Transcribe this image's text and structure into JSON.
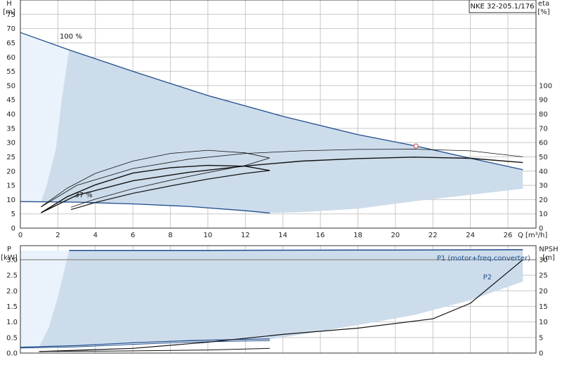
{
  "model_label": "NKE 32-205.1/176",
  "chart_data": [
    {
      "type": "line",
      "panel": "head-efficiency",
      "xlabel": "Q [m³/h]",
      "ylabel_left_name": "H",
      "ylabel_left_unit": "[m]",
      "ylabel_right_name": "eta",
      "ylabel_right_unit": "[%]",
      "xlim": [
        0,
        27.5
      ],
      "ylim_left": [
        0,
        80
      ],
      "ylim_right_ticks": [
        0,
        100
      ],
      "x_ticks": [
        0,
        2,
        4,
        6,
        8,
        10,
        12,
        14,
        16,
        18,
        20,
        22,
        24,
        26
      ],
      "y_ticks_left": [
        0,
        5,
        10,
        15,
        20,
        25,
        30,
        35,
        40,
        45,
        50,
        55,
        60,
        65,
        70,
        75
      ],
      "y_ticks_right": [
        0,
        10,
        20,
        30,
        40,
        50,
        60,
        70,
        80,
        90,
        100
      ],
      "grid": true,
      "annotations": [
        {
          "text": "100 %",
          "x": 2.1,
          "y": 66.5
        },
        {
          "text": "37 %",
          "x": 2.9,
          "y": 10.8
        }
      ],
      "duty_point": {
        "x": 21.1,
        "y": 28.8
      },
      "series": [
        {
          "role": "max-speed-head",
          "points": [
            [
              0,
              68.6
            ],
            [
              2.6,
              62.5
            ],
            [
              6,
              55
            ],
            [
              10,
              46.5
            ],
            [
              14,
              39.2
            ],
            [
              18,
              32.8
            ],
            [
              21.1,
              28.8
            ],
            [
              24,
              24.5
            ],
            [
              26.8,
              20.5
            ]
          ]
        },
        {
          "role": "min-speed-head",
          "points": [
            [
              0,
              9.3
            ],
            [
              3,
              9.1
            ],
            [
              6,
              8.5
            ],
            [
              9,
              7.6
            ],
            [
              12,
              6.1
            ],
            [
              13.3,
              5.3
            ]
          ]
        },
        {
          "role": "operating-area",
          "points": [
            [
              2.6,
              62.5
            ],
            [
              6,
              55
            ],
            [
              10,
              46.5
            ],
            [
              14,
              39.2
            ],
            [
              18,
              32.8
            ],
            [
              21.1,
              28.8
            ],
            [
              24,
              24.5
            ],
            [
              26.8,
              20.5
            ],
            [
              26.8,
              13.8
            ],
            [
              24,
              11.7
            ],
            [
              21,
              9.4
            ],
            [
              18,
              6.8
            ],
            [
              15,
              5.6
            ],
            [
              13.3,
              5.3
            ],
            [
              12,
              6.1
            ],
            [
              9,
              7.6
            ],
            [
              6,
              8.5
            ],
            [
              3,
              9.1
            ],
            [
              1.1,
              9.2
            ],
            [
              1.4,
              15
            ],
            [
              1.9,
              28
            ],
            [
              2.2,
              45
            ],
            [
              2.6,
              62.5
            ]
          ]
        },
        {
          "role": "outside-area",
          "points": [
            [
              0,
              68.6
            ],
            [
              2.6,
              62.5
            ],
            [
              2.2,
              45
            ],
            [
              1.9,
              28
            ],
            [
              1.4,
              15
            ],
            [
              1.1,
              9.2
            ],
            [
              0,
              9.3
            ]
          ]
        },
        {
          "role": "efficiency-motor-max",
          "points": [
            [
              1.1,
              5.4
            ],
            [
              3,
              11.5
            ],
            [
              6,
              16.6
            ],
            [
              9,
              19.6
            ],
            [
              12,
              21.8
            ],
            [
              15,
              23.5
            ],
            [
              18,
              24.4
            ],
            [
              21,
              24.9
            ],
            [
              24,
              24.5
            ],
            [
              26.8,
              23
            ]
          ]
        },
        {
          "role": "efficiency-pump-max",
          "points": [
            [
              1.1,
              7.4
            ],
            [
              3,
              15
            ],
            [
              6,
              20.9
            ],
            [
              9,
              24.2
            ],
            [
              12,
              26.2
            ],
            [
              15,
              27.1
            ],
            [
              18,
              27.6
            ],
            [
              21,
              27.7
            ],
            [
              24,
              27.1
            ],
            [
              26.8,
              25
            ]
          ]
        },
        {
          "role": "efficiency-motor-min",
          "points": [
            [
              1.1,
              5.4
            ],
            [
              2.5,
              11
            ],
            [
              4,
              15.2
            ],
            [
              6,
              19.3
            ],
            [
              8,
              21.2
            ],
            [
              10,
              22
            ],
            [
              12,
              21.7
            ],
            [
              13.3,
              20.2
            ]
          ]
        },
        {
          "role": "efficiency-pump-min",
          "points": [
            [
              1.1,
              7.5
            ],
            [
              2.5,
              14
            ],
            [
              4,
              19.2
            ],
            [
              6,
              23.5
            ],
            [
              8,
              26.2
            ],
            [
              10,
              27.3
            ],
            [
              12,
              26.4
            ],
            [
              13.3,
              24.6
            ]
          ]
        },
        {
          "role": "efficiency-motor-aux-37",
          "points": [
            [
              2.7,
              6.5
            ],
            [
              4,
              9
            ],
            [
              6,
              12.2
            ],
            [
              8,
              14.8
            ],
            [
              10,
              17.2
            ],
            [
              12,
              19.2
            ],
            [
              13.3,
              20.2
            ]
          ]
        },
        {
          "role": "efficiency-pump-aux-37",
          "points": [
            [
              2.7,
              7.3
            ],
            [
              4,
              10.2
            ],
            [
              6,
              13.8
            ],
            [
              8,
              16.8
            ],
            [
              10,
              19.5
            ],
            [
              12,
              22
            ],
            [
              13.3,
              24.6
            ]
          ]
        }
      ]
    },
    {
      "type": "line",
      "panel": "power-npsh",
      "ylabel_left_name": "P",
      "ylabel_left_unit": "[kW]",
      "ylabel_right_name": "NPSH",
      "ylabel_right_unit": "[m]",
      "xlim": [
        0,
        27.5
      ],
      "ylim_left": [
        0,
        3.45
      ],
      "ylim_right": [
        0,
        34.5
      ],
      "y_ticks_left": [
        0.0,
        0.5,
        1.0,
        1.5,
        2.0,
        2.5,
        3.0
      ],
      "y_ticks_right": [
        0,
        5,
        10,
        15,
        20,
        25,
        30
      ],
      "grid": true,
      "legend": [
        {
          "key": "p1",
          "text": "P1 (motor+freq.converter)"
        },
        {
          "key": "p2",
          "text": "P2"
        }
      ],
      "series": [
        {
          "role": "p1-max",
          "points": [
            [
              2.6,
              3.3
            ],
            [
              10,
              3.3
            ],
            [
              20,
              3.31
            ],
            [
              26.8,
              3.32
            ]
          ]
        },
        {
          "role": "p2-level",
          "points": [
            [
              0,
              3.0
            ],
            [
              27.5,
              3.0
            ]
          ]
        },
        {
          "role": "power-area",
          "points": [
            [
              2.6,
              3.3
            ],
            [
              10,
              3.3
            ],
            [
              20,
              3.31
            ],
            [
              26.8,
              3.32
            ],
            [
              26.8,
              2.3
            ],
            [
              24,
              1.7
            ],
            [
              21,
              1.22
            ],
            [
              18,
              0.9
            ],
            [
              15,
              0.6
            ],
            [
              13.3,
              0.44
            ],
            [
              10,
              0.4
            ],
            [
              6,
              0.32
            ],
            [
              2,
              0.22
            ],
            [
              1.0,
              0.2
            ],
            [
              1.5,
              0.8
            ],
            [
              2.0,
              1.8
            ],
            [
              2.6,
              3.3
            ]
          ]
        },
        {
          "role": "power-outside-area",
          "points": [
            [
              0,
              3.3
            ],
            [
              2.6,
              3.3
            ],
            [
              2.0,
              1.8
            ],
            [
              1.5,
              0.8
            ],
            [
              1.0,
              0.2
            ],
            [
              0,
              0.2
            ]
          ]
        },
        {
          "role": "p1-min",
          "points": [
            [
              0,
              0.19
            ],
            [
              3,
              0.24
            ],
            [
              6,
              0.33
            ],
            [
              9,
              0.4
            ],
            [
              12,
              0.44
            ],
            [
              13.3,
              0.45
            ]
          ]
        },
        {
          "role": "p2-min",
          "points": [
            [
              0,
              0.16
            ],
            [
              3,
              0.2
            ],
            [
              6,
              0.28
            ],
            [
              9,
              0.35
            ],
            [
              12,
              0.39
            ],
            [
              13.3,
              0.4
            ]
          ]
        },
        {
          "role": "npsh",
          "points": [
            [
              1.0,
              0.05
            ],
            [
              6,
              0.15
            ],
            [
              10,
              0.35
            ],
            [
              14,
              0.6
            ],
            [
              18,
              0.8
            ],
            [
              22,
              1.1
            ],
            [
              24,
              1.6
            ],
            [
              26.8,
              3.0
            ]
          ]
        },
        {
          "role": "npsh-min",
          "points": [
            [
              1.0,
              0.05
            ],
            [
              6,
              0.07
            ],
            [
              10,
              0.1
            ],
            [
              13.3,
              0.15
            ]
          ]
        }
      ]
    }
  ]
}
